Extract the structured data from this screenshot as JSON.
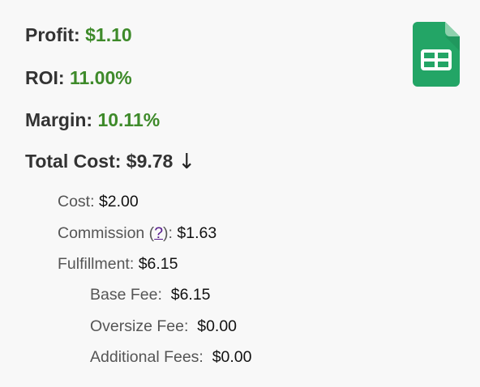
{
  "summary": {
    "profit_label": "Profit: ",
    "profit_value": "$1.10",
    "roi_label": "ROI: ",
    "roi_value": "11.00%",
    "margin_label": "Margin: ",
    "margin_value": "10.11%",
    "total_cost_label": "Total Cost: ",
    "total_cost_value": "$9.78",
    "expand_arrow": "↓"
  },
  "breakdown": {
    "cost_label": "Cost: ",
    "cost_value": "$2.00",
    "commission_label_before": "Commission (",
    "commission_help": "?",
    "commission_label_after": "): ",
    "commission_value": "$1.63",
    "fulfillment_label": "Fulfillment: ",
    "fulfillment_value": "$6.15",
    "base_fee_label": "Base Fee: ",
    "base_fee_value": "$6.15",
    "oversize_fee_label": "Oversize Fee: ",
    "oversize_fee_value": "$0.00",
    "additional_fees_label": "Additional Fees: ",
    "additional_fees_value": "$0.00"
  },
  "colors": {
    "positive_value": "#3e8a2a",
    "sheets_green": "#23a566",
    "link": "#551a8b"
  },
  "icons": {
    "export_icon": "google-sheets-icon"
  }
}
